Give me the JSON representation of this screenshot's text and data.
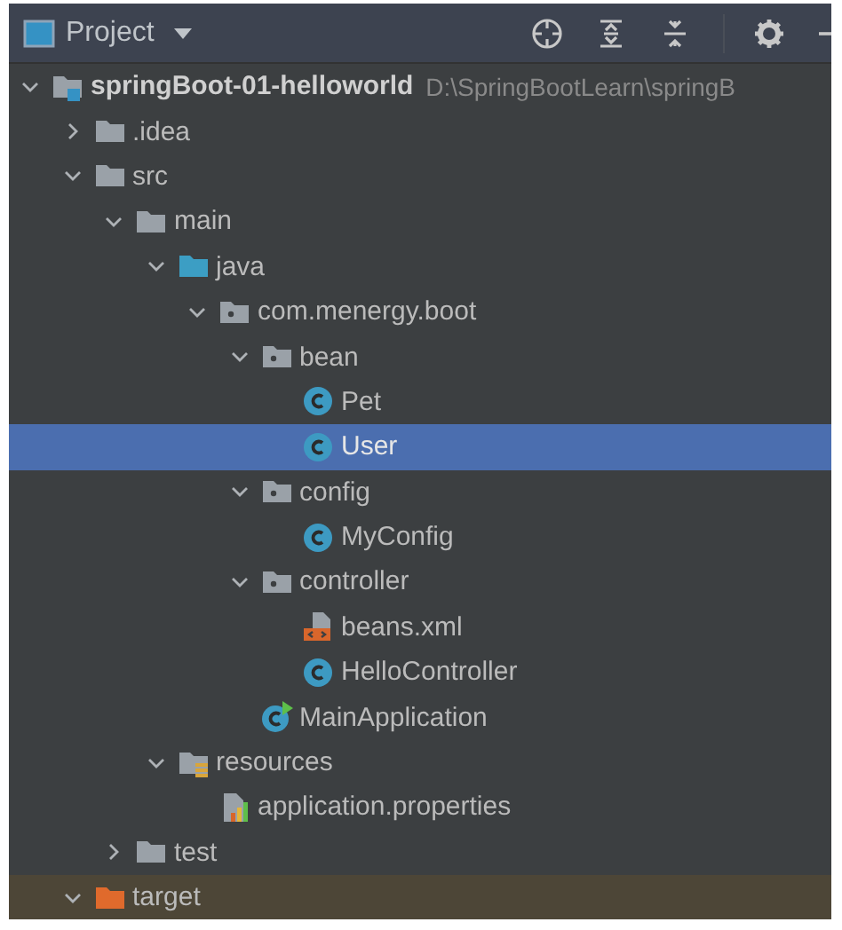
{
  "panel": {
    "title": "Project"
  },
  "tree": [
    {
      "kind": "module",
      "name": "springBoot-01-helloworld",
      "path": "D:\\SpringBootLearn\\springB",
      "expanded": true,
      "selected": false,
      "children": [
        {
          "kind": "folder",
          "name": ".idea",
          "expanded": false,
          "selected": false
        },
        {
          "kind": "folder",
          "name": "src",
          "expanded": true,
          "selected": false,
          "children": [
            {
              "kind": "folder",
              "name": "main",
              "expanded": true,
              "selected": false,
              "children": [
                {
                  "kind": "source-folder",
                  "name": "java",
                  "expanded": true,
                  "selected": false,
                  "children": [
                    {
                      "kind": "package",
                      "name": "com.menergy.boot",
                      "expanded": true,
                      "selected": false,
                      "children": [
                        {
                          "kind": "package",
                          "name": "bean",
                          "expanded": true,
                          "selected": false,
                          "children": [
                            {
                              "kind": "class",
                              "name": "Pet",
                              "selected": false
                            },
                            {
                              "kind": "class",
                              "name": "User",
                              "selected": true
                            }
                          ]
                        },
                        {
                          "kind": "package",
                          "name": "config",
                          "expanded": true,
                          "selected": false,
                          "children": [
                            {
                              "kind": "class",
                              "name": "MyConfig",
                              "selected": false
                            }
                          ]
                        },
                        {
                          "kind": "package",
                          "name": "controller",
                          "expanded": true,
                          "selected": false,
                          "children": [
                            {
                              "kind": "xml",
                              "name": "beans.xml",
                              "selected": false
                            },
                            {
                              "kind": "class",
                              "name": "HelloController",
                              "selected": false
                            }
                          ]
                        },
                        {
                          "kind": "main-class",
                          "name": "MainApplication",
                          "selected": false
                        }
                      ]
                    }
                  ]
                },
                {
                  "kind": "resources",
                  "name": "resources",
                  "expanded": true,
                  "selected": false,
                  "children": [
                    {
                      "kind": "properties",
                      "name": "application.properties",
                      "selected": false
                    }
                  ]
                }
              ]
            },
            {
              "kind": "folder",
              "name": "test",
              "expanded": false,
              "selected": false
            }
          ]
        },
        {
          "kind": "excluded-folder",
          "name": "target",
          "expanded": true,
          "selected": false
        }
      ]
    }
  ]
}
